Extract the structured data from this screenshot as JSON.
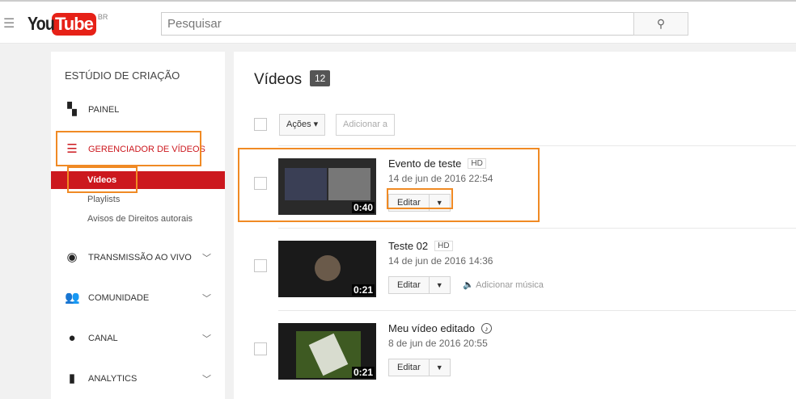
{
  "header": {
    "brand_you": "You",
    "brand_tube": "Tube",
    "region": "BR",
    "search_placeholder": "Pesquisar"
  },
  "sidebar": {
    "title": "ESTÚDIO DE CRIAÇÃO",
    "items": [
      {
        "label": "PAINEL"
      },
      {
        "label": "GERENCIADOR DE VÍDEOS"
      },
      {
        "label": "TRANSMISSÃO AO VIVO"
      },
      {
        "label": "COMUNIDADE"
      },
      {
        "label": "CANAL"
      },
      {
        "label": "ANALYTICS"
      }
    ],
    "subitems": [
      {
        "label": "Vídeos"
      },
      {
        "label": "Playlists"
      },
      {
        "label": "Avisos de Direitos autorais"
      }
    ]
  },
  "main": {
    "title": "Vídeos",
    "count": "12",
    "actions_label": "Ações ▾",
    "add_to_label": "Adicionar a",
    "edit_label": "Editar",
    "add_music_label": "Adicionar música",
    "videos": [
      {
        "title": "Evento de teste",
        "badge": "HD",
        "date": "14 de jun de 2016 22:54",
        "duration": "0:40"
      },
      {
        "title": "Teste 02",
        "badge": "HD",
        "date": "14 de jun de 2016 14:36",
        "duration": "0:21"
      },
      {
        "title": "Meu vídeo editado",
        "badge": "♪",
        "date": "8 de jun de 2016 20:55",
        "duration": "0:21"
      }
    ]
  },
  "colors": {
    "brand": "#e62117",
    "active": "#cc181e",
    "highlight": "#f08a24"
  }
}
